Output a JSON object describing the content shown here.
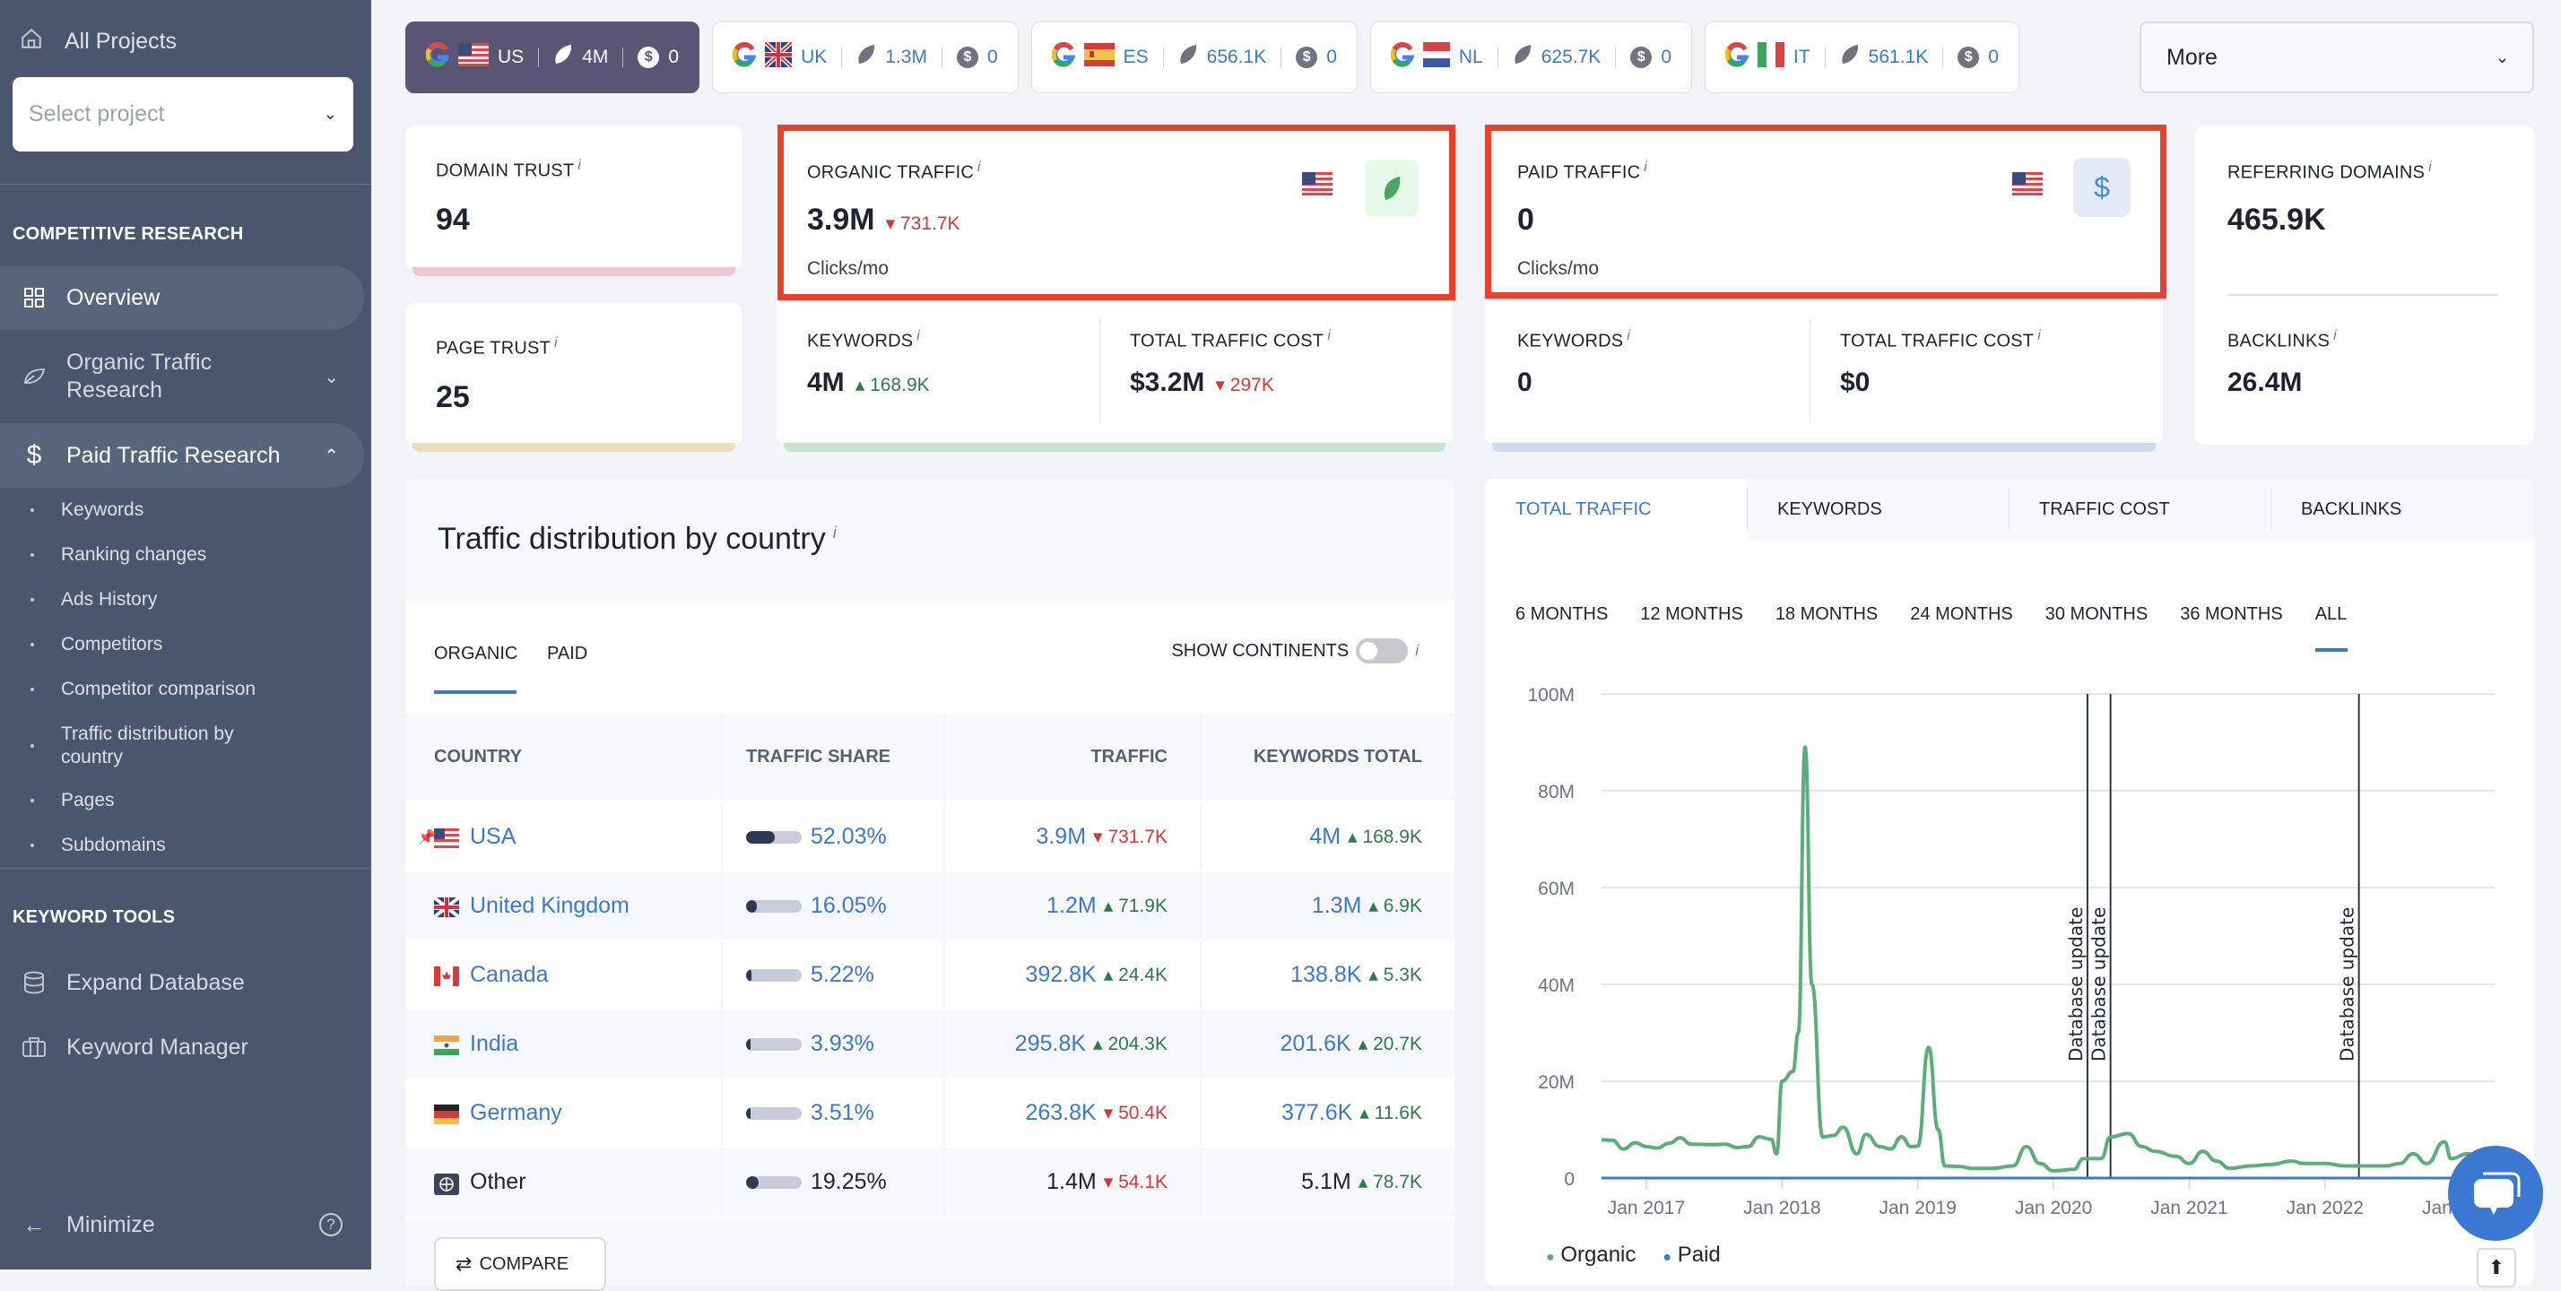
{
  "sidebar": {
    "all_projects": "All Projects",
    "select_project_placeholder": "Select project",
    "sections": [
      {
        "title": "COMPETITIVE RESEARCH"
      },
      {
        "title": "KEYWORD TOOLS"
      }
    ],
    "items": [
      {
        "label": "Overview",
        "icon": "grid-icon",
        "active": true
      },
      {
        "label": "Organic Traffic Research",
        "icon": "leaf-icon",
        "expanded": false
      },
      {
        "label": "Paid Traffic Research",
        "icon": "dollar-icon",
        "expanded": true
      }
    ],
    "sub_items": [
      "Keywords",
      "Ranking changes",
      "Ads History",
      "Competitors",
      "Competitor comparison",
      "Traffic distribution by country",
      "Pages",
      "Subdomains"
    ],
    "tools": [
      {
        "label": "Expand Database",
        "icon": "database-icon"
      },
      {
        "label": "Keyword Manager",
        "icon": "briefcase-icon"
      }
    ],
    "minimize": "Minimize"
  },
  "engine_tabs": [
    {
      "country": "US",
      "organic": "4M",
      "paid": "0",
      "active": true
    },
    {
      "country": "UK",
      "organic": "1.3M",
      "paid": "0"
    },
    {
      "country": "ES",
      "organic": "656.1K",
      "paid": "0"
    },
    {
      "country": "NL",
      "organic": "625.7K",
      "paid": "0"
    },
    {
      "country": "IT",
      "organic": "561.1K",
      "paid": "0"
    }
  ],
  "more_label": "More",
  "metrics": {
    "domain_trust": {
      "label": "DOMAIN TRUST",
      "value": "94"
    },
    "page_trust": {
      "label": "PAGE TRUST",
      "value": "25"
    },
    "organic": {
      "label": "ORGANIC TRAFFIC",
      "value": "3.9M",
      "delta": "731.7K",
      "unit": "Clicks/mo",
      "keywords_label": "KEYWORDS",
      "keywords": "4M",
      "keywords_delta": "168.9K",
      "cost_label": "TOTAL TRAFFIC COST",
      "cost": "$3.2M",
      "cost_delta": "297K"
    },
    "paid": {
      "label": "PAID TRAFFIC",
      "value": "0",
      "unit": "Clicks/mo",
      "keywords_label": "KEYWORDS",
      "keywords": "0",
      "cost_label": "TOTAL TRAFFIC COST",
      "cost": "$0"
    },
    "referring": {
      "label": "REFERRING DOMAINS",
      "value": "465.9K"
    },
    "backlinks": {
      "label": "BACKLINKS",
      "value": "26.4M"
    },
    "info_mark": "i"
  },
  "distribution": {
    "title": "Traffic distribution by country",
    "tabs": [
      "ORGANIC",
      "PAID"
    ],
    "show_continents": "SHOW CONTINENTS",
    "columns": [
      "COUNTRY",
      "TRAFFIC SHARE",
      "TRAFFIC",
      "KEYWORDS TOTAL"
    ],
    "rows": [
      {
        "country": "USA",
        "share": "52.03%",
        "share_value": 52.03,
        "traffic": "3.9M",
        "traffic_delta": "731.7K",
        "traffic_dir": "down",
        "keywords": "4M",
        "kw_delta": "168.9K",
        "kw_dir": "up",
        "pinned": true
      },
      {
        "country": "United Kingdom",
        "share": "16.05%",
        "share_value": 16.05,
        "traffic": "1.2M",
        "traffic_delta": "71.9K",
        "traffic_dir": "up",
        "keywords": "1.3M",
        "kw_delta": "6.9K",
        "kw_dir": "up"
      },
      {
        "country": "Canada",
        "share": "5.22%",
        "share_value": 5.22,
        "traffic": "392.8K",
        "traffic_delta": "24.4K",
        "traffic_dir": "up",
        "keywords": "138.8K",
        "kw_delta": "5.3K",
        "kw_dir": "up"
      },
      {
        "country": "India",
        "share": "3.93%",
        "share_value": 3.93,
        "traffic": "295.8K",
        "traffic_delta": "204.3K",
        "traffic_dir": "up",
        "keywords": "201.6K",
        "kw_delta": "20.7K",
        "kw_dir": "up"
      },
      {
        "country": "Germany",
        "share": "3.51%",
        "share_value": 3.51,
        "traffic": "263.8K",
        "traffic_delta": "50.4K",
        "traffic_dir": "down",
        "keywords": "377.6K",
        "kw_delta": "11.6K",
        "kw_dir": "up"
      },
      {
        "country": "Other",
        "share": "19.25%",
        "share_value": 19.25,
        "traffic": "1.4M",
        "traffic_delta": "54.1K",
        "traffic_dir": "down",
        "keywords": "5.1M",
        "kw_delta": "78.7K",
        "kw_dir": "up"
      }
    ],
    "compare": "COMPARE"
  },
  "chart_panel": {
    "tabs": [
      "TOTAL TRAFFIC",
      "KEYWORDS",
      "TRAFFIC COST",
      "BACKLINKS"
    ],
    "ranges": [
      "6 MONTHS",
      "12 MONTHS",
      "18 MONTHS",
      "24 MONTHS",
      "30 MONTHS",
      "36 MONTHS",
      "ALL"
    ],
    "selected_range": "ALL"
  },
  "chart_data": {
    "type": "line",
    "title": "",
    "xlabel": "",
    "ylabel": "",
    "ylim": [
      0,
      100000000
    ],
    "yticks": [
      "0",
      "20M",
      "40M",
      "60M",
      "80M",
      "100M"
    ],
    "xticks": [
      "Jan 2017",
      "Jan 2018",
      "Jan 2019",
      "Jan 2020",
      "Jan 2021",
      "Jan 2022",
      "Jan 2023"
    ],
    "grid": true,
    "legend": "bottom-left",
    "annotations": [
      {
        "x": 2020.25,
        "label": "Database update"
      },
      {
        "x": 2020.42,
        "label": "Database update"
      },
      {
        "x": 2022.25,
        "label": "Database update"
      }
    ],
    "series": [
      {
        "name": "Organic",
        "color": "#5aae7a",
        "points": [
          [
            2016.67,
            7.9
          ],
          [
            2016.75,
            7.8
          ],
          [
            2016.83,
            6.0
          ],
          [
            2016.92,
            7.3
          ],
          [
            2017.0,
            6.5
          ],
          [
            2017.08,
            6.2
          ],
          [
            2017.17,
            7.2
          ],
          [
            2017.25,
            8.3
          ],
          [
            2017.33,
            7.0
          ],
          [
            2017.5,
            6.9
          ],
          [
            2017.58,
            7.0
          ],
          [
            2017.67,
            6.3
          ],
          [
            2017.75,
            6.5
          ],
          [
            2017.83,
            8.5
          ],
          [
            2017.92,
            8.0
          ],
          [
            2017.96,
            5.0
          ],
          [
            2018.0,
            20.0
          ],
          [
            2018.08,
            22.0
          ],
          [
            2018.12,
            30.0
          ],
          [
            2018.17,
            89.0
          ],
          [
            2018.22,
            40.0
          ],
          [
            2018.3,
            8.5
          ],
          [
            2018.38,
            8.8
          ],
          [
            2018.45,
            10.5
          ],
          [
            2018.55,
            5.0
          ],
          [
            2018.62,
            9.0
          ],
          [
            2018.72,
            6.5
          ],
          [
            2018.8,
            6.0
          ],
          [
            2018.88,
            8.5
          ],
          [
            2018.95,
            6.5
          ],
          [
            2019.0,
            6.6
          ],
          [
            2019.08,
            27.0
          ],
          [
            2019.15,
            10.0
          ],
          [
            2019.2,
            2.5
          ],
          [
            2019.3,
            2.4
          ],
          [
            2019.4,
            2.0
          ],
          [
            2019.55,
            2.0
          ],
          [
            2019.7,
            2.5
          ],
          [
            2019.8,
            6.5
          ],
          [
            2019.9,
            3.0
          ],
          [
            2020.0,
            1.5
          ],
          [
            2020.15,
            1.8
          ],
          [
            2020.22,
            4.0
          ],
          [
            2020.35,
            4.0
          ],
          [
            2020.42,
            8.5
          ],
          [
            2020.55,
            9.2
          ],
          [
            2020.65,
            6.5
          ],
          [
            2020.75,
            5.5
          ],
          [
            2020.9,
            4.5
          ],
          [
            2021.0,
            3.0
          ],
          [
            2021.1,
            5.5
          ],
          [
            2021.2,
            3.5
          ],
          [
            2021.3,
            2.0
          ],
          [
            2021.45,
            2.5
          ],
          [
            2021.6,
            2.8
          ],
          [
            2021.75,
            3.5
          ],
          [
            2021.85,
            3.0
          ],
          [
            2022.0,
            3.0
          ],
          [
            2022.15,
            2.5
          ],
          [
            2022.3,
            2.5
          ],
          [
            2022.45,
            2.5
          ],
          [
            2022.55,
            3.0
          ],
          [
            2022.65,
            5.0
          ],
          [
            2022.75,
            3.0
          ],
          [
            2022.88,
            7.5
          ],
          [
            2022.93,
            4.0
          ],
          [
            2023.05,
            5.0
          ],
          [
            2023.15,
            4.5
          ]
        ],
        "unit": "M"
      },
      {
        "name": "Paid",
        "color": "#3b78d1",
        "points": [
          [
            2016.67,
            0
          ],
          [
            2023.15,
            0
          ]
        ],
        "unit": "M"
      }
    ]
  },
  "colors": {
    "accent": "#3b78d1",
    "organic": "#5aae7a",
    "down": "#d03a3a",
    "up": "#2e7a4a",
    "highlight": "#e9412b",
    "sidebar": "#4a566e"
  }
}
